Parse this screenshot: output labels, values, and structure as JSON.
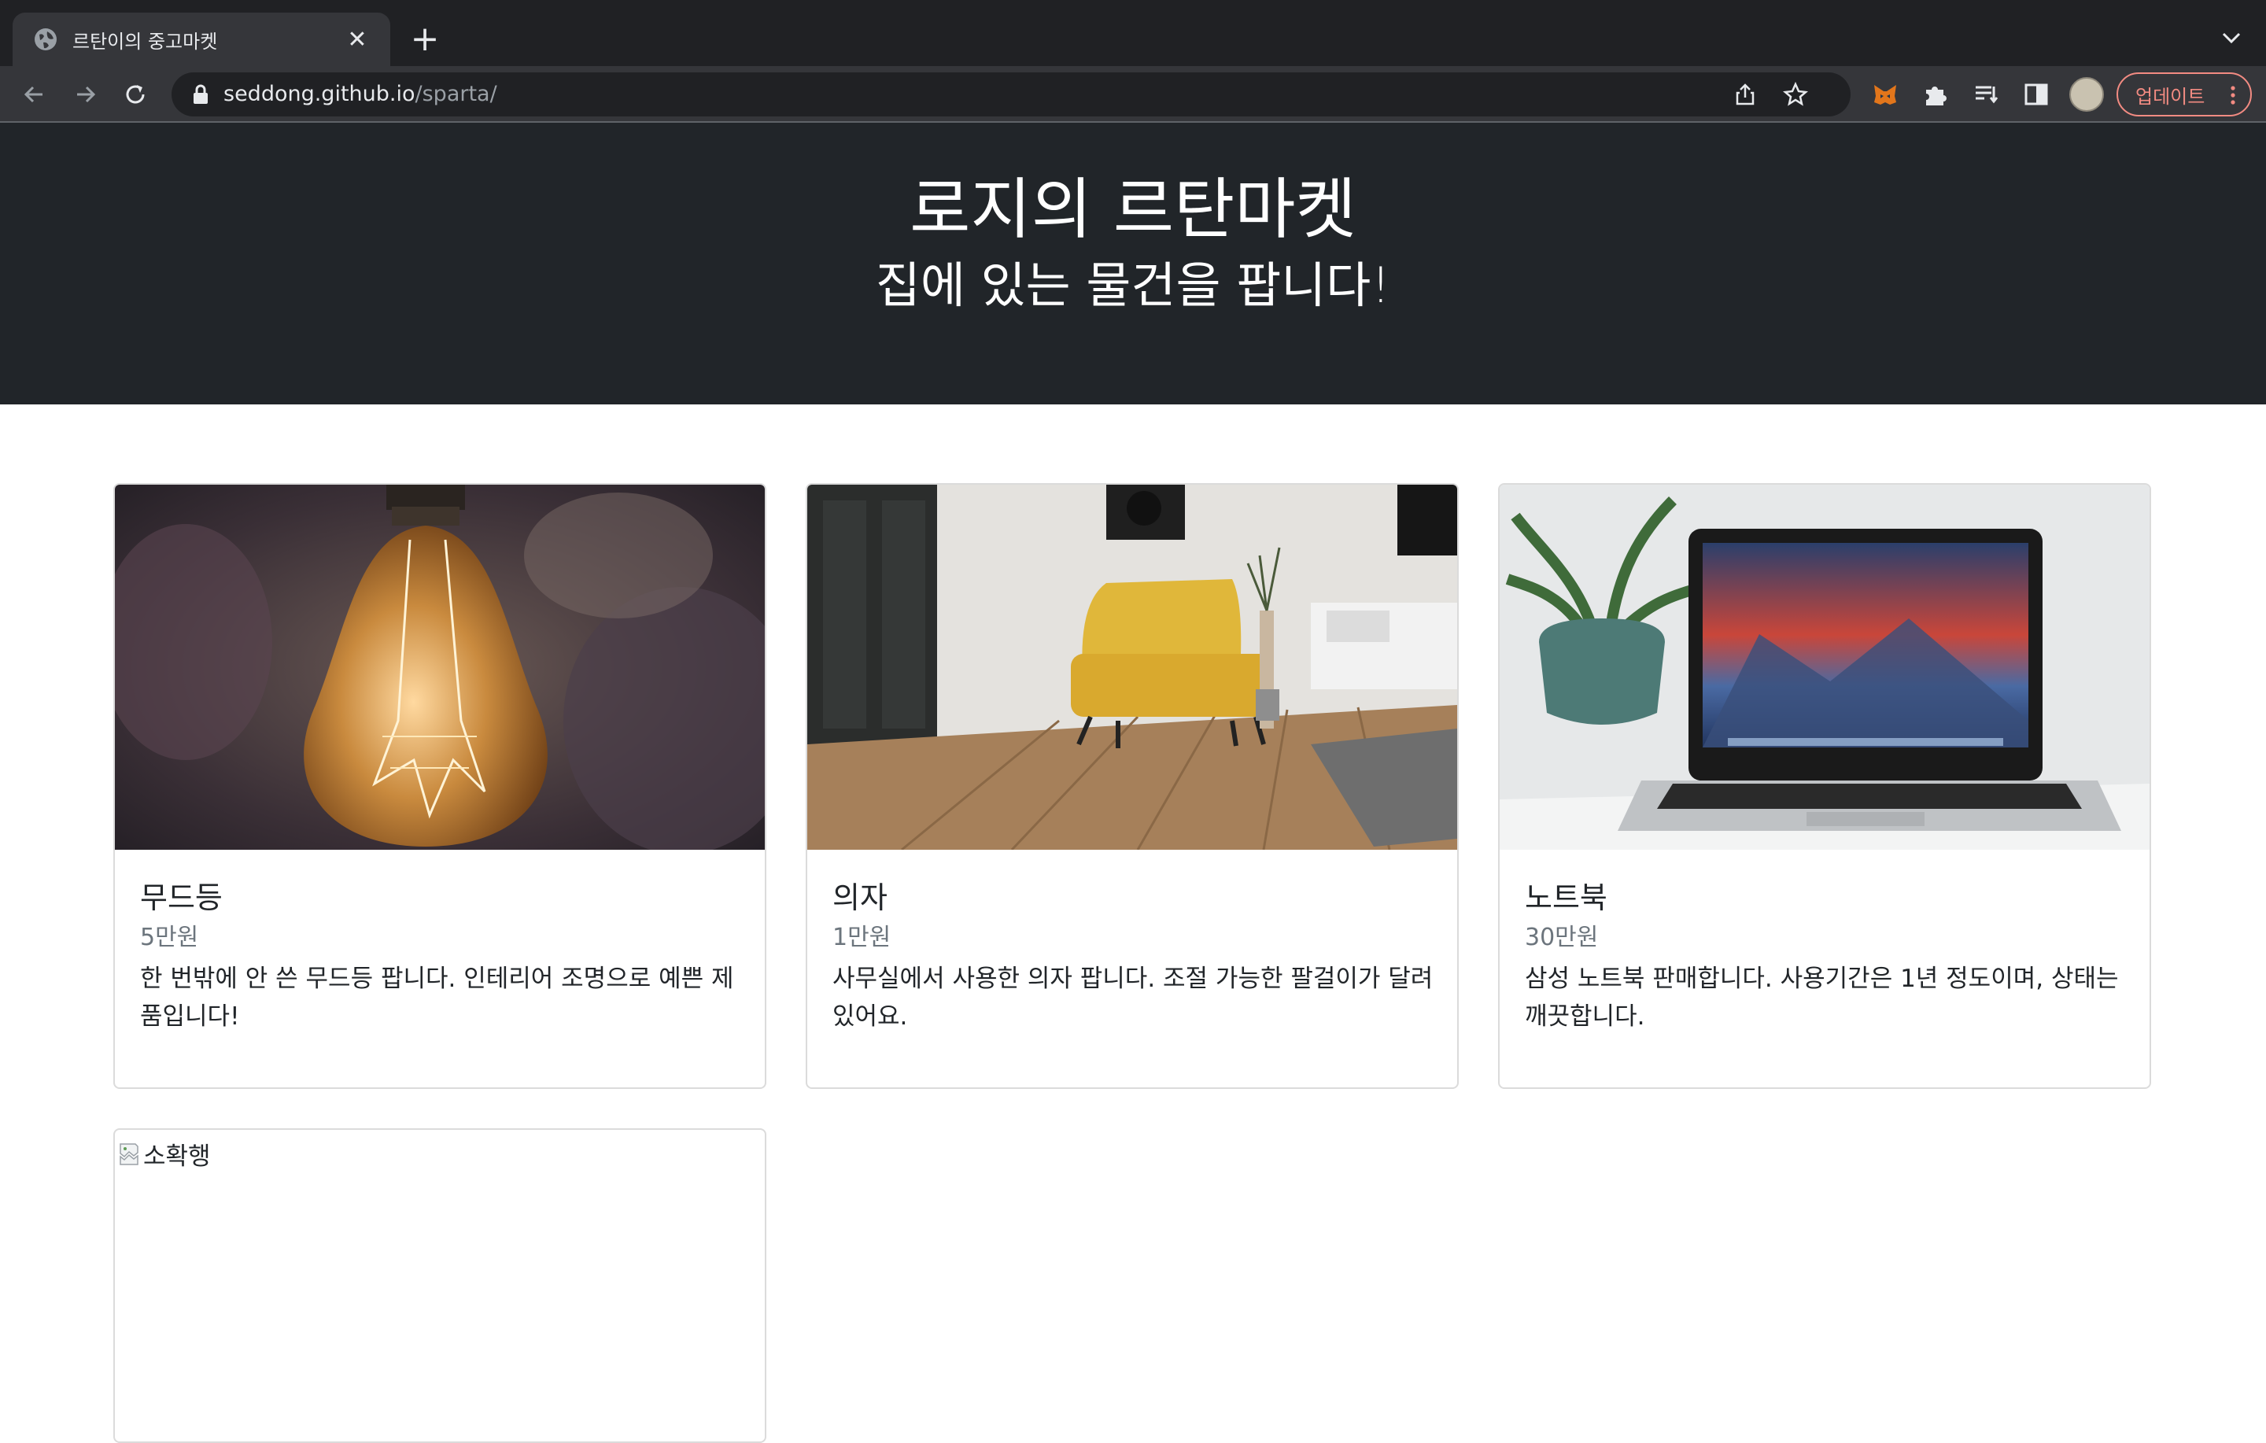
{
  "browser": {
    "tab": {
      "title": "르탄이의 중고마켓",
      "icon": "globe-icon"
    },
    "address": {
      "host": "seddong.github.io",
      "path": "/sparta/"
    },
    "update_label": "업데이트"
  },
  "hero": {
    "title": "로지의 르탄마켓",
    "subtitle": "집에 있는 물건을 팝니다!"
  },
  "products": [
    {
      "title": "무드등",
      "price": "5만원",
      "description": "한 번밖에 안 쓴 무드등 팝니다. 인테리어 조명으로 예쁜 제품입니다!",
      "image": "lightbulb-photo"
    },
    {
      "title": "의자",
      "price": "1만원",
      "description": "사무실에서 사용한 의자 팝니다. 조절 가능한 팔걸이가 달려있어요.",
      "image": "armchair-photo"
    },
    {
      "title": "노트북",
      "price": "30만원",
      "description": "삼성 노트북 판매합니다. 사용기간은 1년 정도이며, 상태는 깨끗합니다.",
      "image": "laptop-photo"
    },
    {
      "image_alt": "소확행",
      "image": "broken-image-icon"
    }
  ],
  "colors": {
    "hero_bg": "#212529",
    "chrome_bg": "#202124",
    "toolbar_bg": "#35363a",
    "update_accent": "#f28b82",
    "price_text": "#6c757d"
  }
}
